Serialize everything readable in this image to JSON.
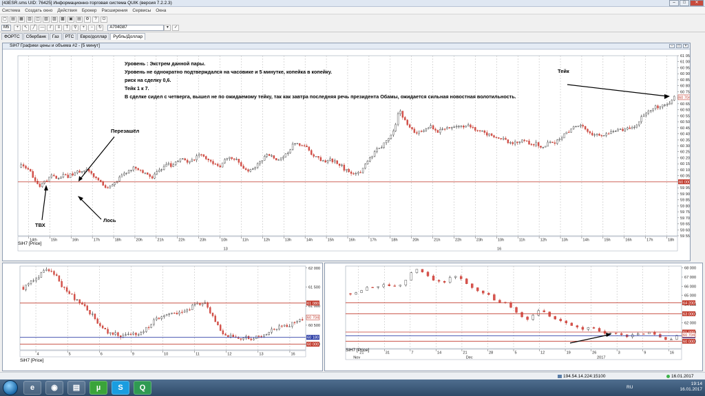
{
  "window": {
    "title": "[43ESR.sms UID: 76425] Информационно-торговая система QUIK (версия 7.2.2.3)",
    "buttons": [
      "–",
      "□",
      "✕"
    ]
  },
  "menu": [
    "Система",
    "Создать окно",
    "Действия",
    "Брокер",
    "Расширения",
    "Сервисы",
    "Окна"
  ],
  "toolbar": {
    "interval": "M5",
    "instrument": "A704G87"
  },
  "tabs": [
    "ФОРТС",
    "Сбербанк",
    "Газ",
    "РТС",
    "Евро/доллар",
    "Рубль/Доллар"
  ],
  "active_tab": 5,
  "main_chart": {
    "title": "SiH7 Графики цены и объема #2 - [5 минут]",
    "series_label": "SiH7 [Price]",
    "annotation_lines": [
      "Уровень : Экстрем данной пары.",
      "Уровень не однократно подтверждался на часовике и 5 минутке, копейка в копейку.",
      "риск на сделку 0,6.",
      "Тейк 1 к 7.",
      "В сделке сидел с четверга, вышел не по ожидаемому тейку, так как завтра последняя речь президента Обамы, ожидается сильная новостная волотильность."
    ],
    "label_overshoot": "Перезашёл",
    "label_entry": "ТВХ",
    "label_stop": "Лось",
    "label_take": "Тейк"
  },
  "bottom_left": {
    "series_label": "SiH7 [Price]"
  },
  "bottom_right": {
    "series_label": "SiH7 [Price]"
  },
  "chart_data": [
    {
      "type": "candlestick",
      "name_shown": "SiH7 [Price]",
      "timeframe": "5 минут",
      "y_ticks": [
        "61 050",
        "61 000",
        "60 950",
        "60 900",
        "60 850",
        "60 800",
        "60 750",
        "60 700",
        "60 650",
        "60 600",
        "60 550",
        "60 500",
        "60 450",
        "60 400",
        "60 350",
        "60 300",
        "60 250",
        "60 200",
        "60 150",
        "60 100",
        "60 050",
        "60 000",
        "59 950",
        "59 900",
        "59 850",
        "59 800",
        "59 750",
        "59 700",
        "59 650",
        "59 600",
        "59 550"
      ],
      "ylim": [
        59550,
        61050
      ],
      "x_ticks": [
        "14th",
        "15h",
        "16h",
        "17h",
        "18h",
        "20h",
        "21h",
        "22h",
        "23h",
        "10h",
        "11h",
        "12h",
        "13h",
        "14h",
        "15h",
        "16h",
        "17h",
        "18h",
        "20h",
        "21h",
        "22h",
        "23h",
        "10h",
        "11h",
        "12h",
        "13h",
        "14h",
        "15h",
        "16h",
        "17h",
        "18h"
      ],
      "x_day_markers": [
        "13",
        "16"
      ],
      "close_path": [
        60120,
        60080,
        59980,
        60040,
        60020,
        60060,
        60100,
        60080,
        60020,
        59960,
        60000,
        60060,
        60120,
        60080,
        60040,
        60100,
        60160,
        60200,
        60160,
        60220,
        60180,
        60140,
        60200,
        60160,
        60100,
        60140,
        60220,
        60180,
        60240,
        60320,
        60280,
        60220,
        60180,
        60160,
        60120,
        60080,
        60100,
        60200,
        60300,
        60380,
        60580,
        60440,
        60420,
        60460,
        60400,
        60440,
        60480,
        60460,
        60420,
        60420,
        60380,
        60340,
        60300,
        60360,
        60320,
        60280,
        60320,
        60380,
        60440,
        60460,
        60420,
        60400,
        60380,
        60420,
        60460,
        60480,
        60560,
        60620,
        60650,
        60704
      ],
      "price_level": 60000,
      "last_price_label": "60 704",
      "level_label": "60 000",
      "grid": true
    },
    {
      "type": "candlestick",
      "name_shown": "SiH7 [Price]",
      "timeframe": "hourly",
      "y_ticks": [
        "62 000",
        "61 500",
        "61 000",
        "60 500",
        "60 000"
      ],
      "ylim": [
        59850,
        62050
      ],
      "x_ticks": [
        "4",
        "5",
        "6",
        "9",
        "10",
        "11",
        "12",
        "13",
        "16"
      ],
      "close_path": [
        61500,
        61700,
        61850,
        61900,
        61750,
        61500,
        61300,
        61050,
        60800,
        60600,
        60400,
        60250,
        60150,
        60200,
        60300,
        60450,
        60600,
        60700,
        60800,
        60900,
        60950,
        61000,
        61050,
        60800,
        60400,
        60200,
        60100,
        60150,
        60200,
        60250,
        60300,
        60400,
        60500,
        60600,
        60704
      ],
      "levels": [
        61080,
        60180,
        60000
      ],
      "level_labels": [
        "61 080",
        "60 180",
        "60 000"
      ],
      "last_price_label": "60 704"
    },
    {
      "type": "candlestick",
      "name_shown": "SiH7 [Price]",
      "timeframe": "daily",
      "y_ticks": [
        "68 000",
        "67 000",
        "66 000",
        "65 000",
        "64 000",
        "63 000",
        "62 000",
        "61 000",
        "60 000"
      ],
      "ylim": [
        59200,
        68200
      ],
      "x_ticks": [
        "21",
        "31",
        "7",
        "14",
        "21",
        "28",
        "5",
        "12",
        "19",
        "26",
        "3",
        "9",
        "16"
      ],
      "x_month_markers": [
        "Nov",
        "Dec",
        "2017"
      ],
      "close_path": [
        65200,
        65600,
        65800,
        66000,
        65700,
        66200,
        68000,
        67500,
        66800,
        66500,
        67000,
        66200,
        65500,
        65000,
        64500,
        64200,
        63000,
        62400,
        63200,
        62600,
        62000,
        61800,
        61500,
        61600,
        61100,
        60900,
        60400,
        60500,
        60800,
        61000,
        60200,
        60704
      ],
      "levels": [
        64200,
        63000,
        61000,
        60600,
        60000
      ],
      "level_labels": [
        "64 200",
        "63 000",
        "61 000",
        "60 600",
        "60 000"
      ],
      "last_price_label": "60 704"
    }
  ],
  "status": {
    "connection": "194.54.14.224:15100",
    "date": "16.01.2017"
  },
  "taskbar": {
    "lang": "RU",
    "time": "19:14",
    "date": "16.01.2017"
  }
}
